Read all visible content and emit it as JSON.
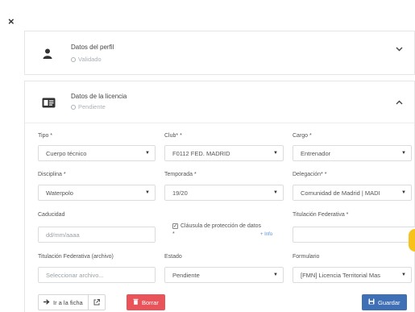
{
  "close_glyph": "×",
  "perfil": {
    "title": "Datos del perfil",
    "status": "Validado",
    "icon": "user-icon",
    "chevron": "⌄"
  },
  "licencia": {
    "title": "Datos de la licencia",
    "status": "Pendiente",
    "icon": "id-card-icon",
    "chevron": "⌃"
  },
  "form": {
    "tipo": {
      "label": "Tipo *",
      "value": "Cuerpo técnico"
    },
    "club": {
      "label": "Club* *",
      "value": "F0112 FED. MADRID"
    },
    "cargo": {
      "label": "Cargo *",
      "value": "Entrenador"
    },
    "disciplina": {
      "label": "Disciplina *",
      "value": "Waterpolo"
    },
    "temporada": {
      "label": "Temporada *",
      "value": "19/20"
    },
    "delegacion": {
      "label": "Delegación* *",
      "value": "Comunidad de Madrid | MADI"
    },
    "caducidad": {
      "label": "Caducidad",
      "placeholder": "dd/mm/aaaa"
    },
    "clausula": {
      "label": "Cláusula de protección de datos",
      "asterisk": "*",
      "info": "+ Info"
    },
    "titulacion": {
      "label": "Titulación Federativa *",
      "value": ""
    },
    "titulacion_archivo": {
      "label": "Titulación Federativa (archivo)",
      "value": "Seleccionar archivo..."
    },
    "estado": {
      "label": "Estado",
      "value": "Pendiente"
    },
    "formulario": {
      "label": "Formulario",
      "value": "[FMN] Licencia Territorial Mas"
    }
  },
  "buttons": {
    "ir_ficha": "Ir a la ficha",
    "borrar": "Borrar",
    "guardar": "Guardar"
  },
  "colors": {
    "borrar": "#e9545a",
    "guardar": "#3f6fb5",
    "accent_blob": "#f7c31b"
  }
}
